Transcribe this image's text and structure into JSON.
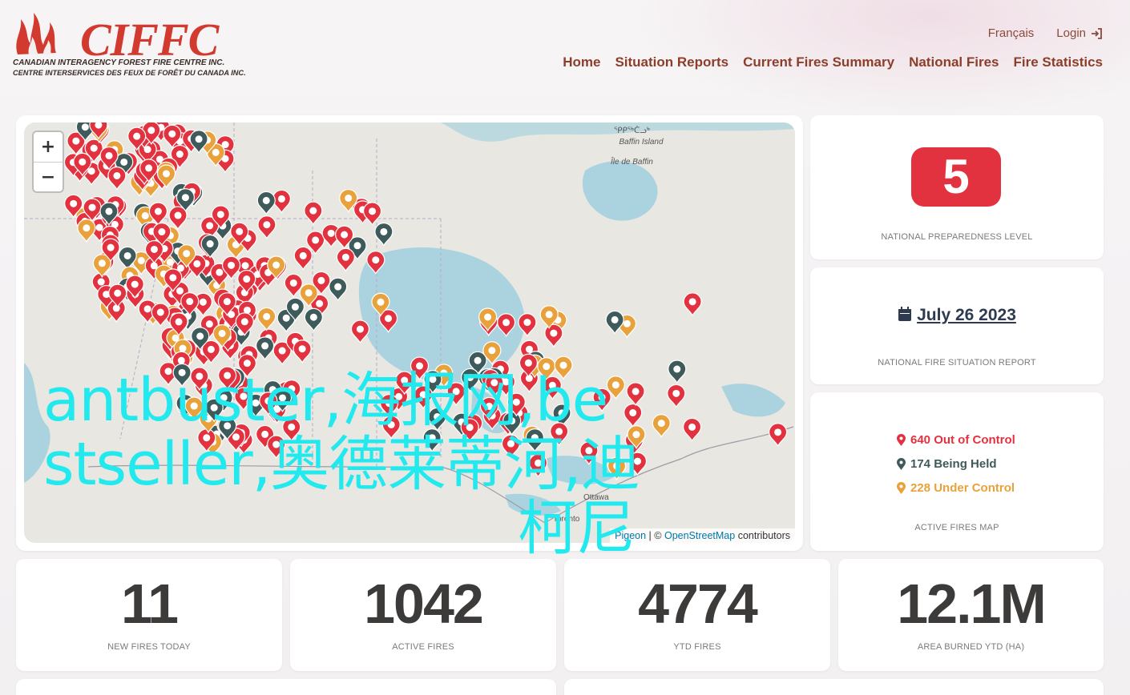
{
  "header": {
    "logo_word": "CIFFC",
    "logo_line1": "CANADIAN INTERAGENCY FOREST FIRE CENTRE INC.",
    "logo_line2": "CENTRE INTERSERVICES DES FEUX DE FORÊT DU CANADA INC.",
    "language_link": "Français",
    "login_link": "Login",
    "nav": [
      "Home",
      "Situation Reports",
      "Current Fires Summary",
      "National Fires",
      "Fire Statistics"
    ]
  },
  "map": {
    "zoom_in": "+",
    "zoom_out": "−",
    "attribution": {
      "pigeon": "Pigeon",
      "sep": " | © ",
      "osm": "OpenStreetMap",
      "suffix": " contributors"
    },
    "places": {
      "baffin_syllabics": "ᕿᑭᖅᑖᓗᒃ",
      "baffin_en": "Baffin Island",
      "baffin_fr": "Île de Baffin",
      "ottawa": "Ottawa",
      "toronto": "Toronto"
    },
    "watermark": [
      "antbuster,海报网,be",
      "stseller,奥德莱蒂河,迪",
      "柯尼"
    ]
  },
  "preparedness": {
    "level": "5",
    "label": "NATIONAL PREPAREDNESS LEVEL",
    "color": "#e2323f"
  },
  "situation_report": {
    "date": "July 26 2023",
    "label": "NATIONAL FIRE SITUATION REPORT"
  },
  "active_fires_map": {
    "label": "ACTIVE FIRES MAP",
    "legend": [
      {
        "text": "640 Out of Control",
        "color": "#e2323f"
      },
      {
        "text": "174 Being Held",
        "color": "#3f5a5b"
      },
      {
        "text": "228 Under Control",
        "color": "#e9a23b"
      }
    ]
  },
  "stats": [
    {
      "value": "11",
      "label": "NEW FIRES TODAY"
    },
    {
      "value": "1042",
      "label": "ACTIVE FIRES"
    },
    {
      "value": "4774",
      "label": "YTD FIRES"
    },
    {
      "value": "12.1M",
      "label": "AREA BURNED YTD (HA)"
    }
  ]
}
